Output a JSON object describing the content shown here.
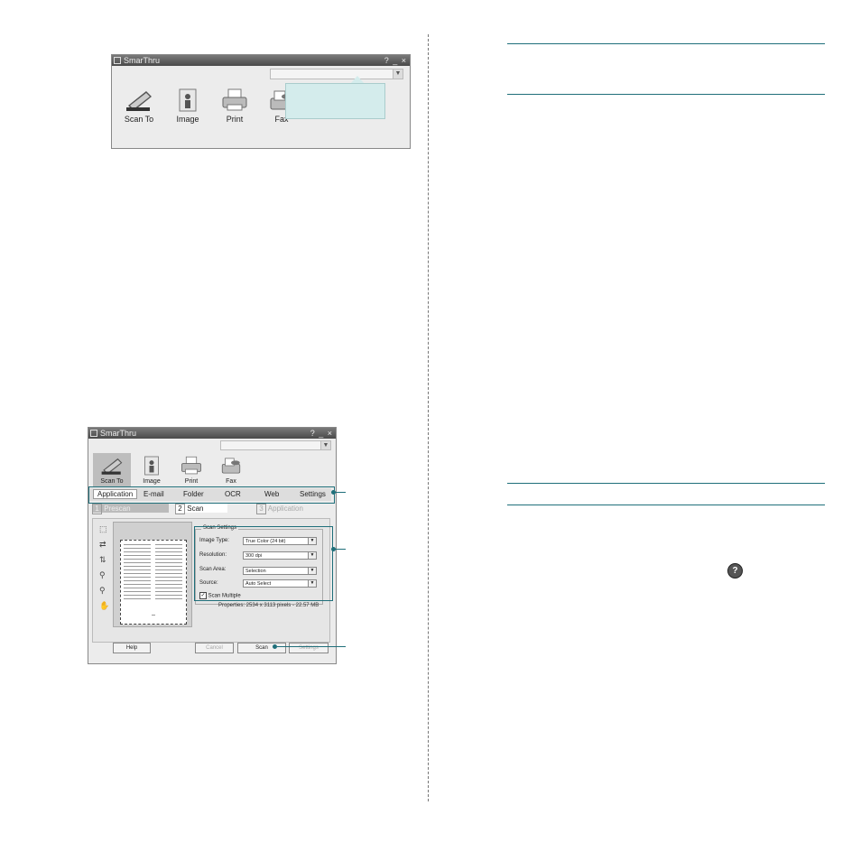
{
  "window1": {
    "title": "SmarThru",
    "controls": "? _ ×",
    "tools": [
      {
        "label": "Scan To",
        "icon": "scanner-icon"
      },
      {
        "label": "Image",
        "icon": "image-icon"
      },
      {
        "label": "Print",
        "icon": "printer-icon"
      },
      {
        "label": "Fax",
        "icon": "fax-icon"
      }
    ]
  },
  "window2": {
    "title": "SmarThru",
    "controls": "? _ ×",
    "tools": [
      {
        "label": "Scan To",
        "icon": "scanner-icon"
      },
      {
        "label": "Image",
        "icon": "image-icon"
      },
      {
        "label": "Print",
        "icon": "printer-icon"
      },
      {
        "label": "Fax",
        "icon": "fax-icon"
      }
    ],
    "tabs": [
      "Application",
      "E-mail",
      "Folder",
      "OCR",
      "Web",
      "Settings"
    ],
    "steps": [
      {
        "num": "1",
        "label": "Prescan"
      },
      {
        "num": "2",
        "label": "Scan"
      },
      {
        "num": "3",
        "label": "Application"
      }
    ],
    "scan_settings": {
      "group_label": "Scan Settings",
      "image_type_label": "Image Type:",
      "image_type_value": "True Color (24 bit)",
      "resolution_label": "Resolution:",
      "resolution_value": "300 dpi",
      "scan_area_label": "Scan Area:",
      "scan_area_value": "Selection",
      "source_label": "Source:",
      "source_value": "Auto Select",
      "scan_multiple_label": "Scan Multiple",
      "scan_multiple_checked": true
    },
    "properties": "Properties: 2534 x 3113 pixels - 22.57 MB",
    "buttons": {
      "help": "Help",
      "cancel": "Cancel",
      "scan": "Scan",
      "settings": "Settings"
    }
  },
  "help_glyph": "?"
}
